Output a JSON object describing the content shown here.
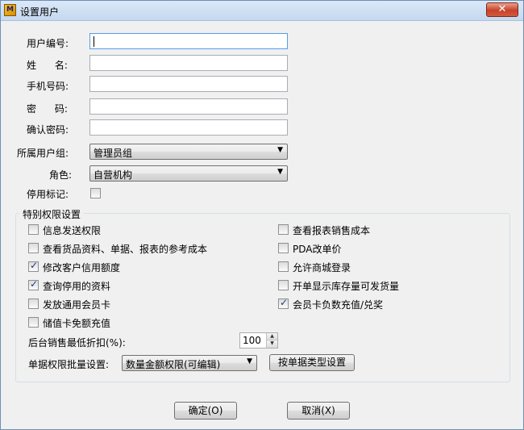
{
  "window": {
    "title": "设置用户",
    "close_icon": "✕"
  },
  "form": {
    "user_no_label": "用户编号:",
    "name_label": "姓      名:",
    "phone_label": "手机号码:",
    "password_label": "密      码:",
    "confirm_label": "确认密码:",
    "group_label": "所属用户组:",
    "group_value": "管理员组",
    "role_label": "角色:",
    "role_value": "自营机构",
    "disabled_label": "停用标记:",
    "user_no_value": "",
    "name_value": "",
    "phone_value": "",
    "password_value": "",
    "confirm_value": ""
  },
  "permissions": {
    "title": "特别权限设置",
    "items": [
      {
        "label": "信息发送权限",
        "checked": false
      },
      {
        "label": "查看货品资料、单据、报表的参考成本",
        "checked": false
      },
      {
        "label": "修改客户信用额度",
        "checked": true
      },
      {
        "label": "查询停用的资料",
        "checked": true
      },
      {
        "label": "发放通用会员卡",
        "checked": false
      },
      {
        "label": "储值卡免额充值",
        "checked": false
      },
      {
        "label": "查看报表销售成本",
        "checked": false
      },
      {
        "label": "PDA改单价",
        "checked": false
      },
      {
        "label": "允许商城登录",
        "checked": false
      },
      {
        "label": "开单显示库存量可发货量",
        "checked": false
      },
      {
        "label": "会员卡负数充值/兑奖",
        "checked": true
      }
    ],
    "discount_label": "后台销售最低折扣(%):",
    "discount_value": "100",
    "batch_label": "单据权限批量设置:",
    "batch_value": "数量金额权限(可编辑)",
    "by_type_button": "按单据类型设置"
  },
  "buttons": {
    "ok": "确定(O)",
    "cancel": "取消(X)"
  }
}
